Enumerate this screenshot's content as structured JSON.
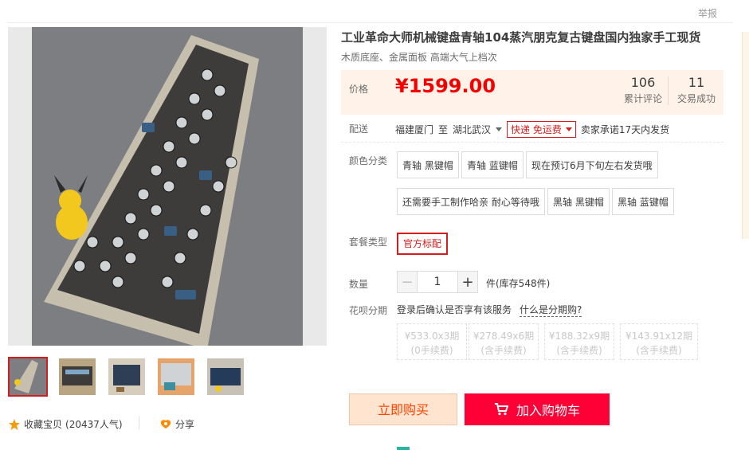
{
  "header": {
    "report_label": "举报"
  },
  "product": {
    "title": "工业革命大师机械键盘青轴104蒸汽朋克复古键盘国内独家手工现货",
    "subtitle": "木质底座、金属面板 高端大气上档次",
    "image_alt_icon": "keyboard-photo"
  },
  "gallery": {
    "thumbnail_count": 5,
    "active_index": 0
  },
  "price": {
    "label": "价格",
    "value": "¥1599.00"
  },
  "stats": [
    {
      "num": "106",
      "label": "累计评论"
    },
    {
      "num": "11",
      "label": "交易成功"
    }
  ],
  "delivery": {
    "label": "配送",
    "from": "福建厦门",
    "to_word": "至",
    "dest": "湖北武汉",
    "shipping": "快递 免运费",
    "promise": "卖家承诺17天内发货"
  },
  "color": {
    "label": "颜色分类",
    "options": [
      "青轴 黑键帽",
      "青轴 蓝键帽",
      "现在预订6月下旬左右发货哦",
      "还需要手工制作哈亲 耐心等待哦",
      "黑轴 黑键帽",
      "黑轴 蓝键帽"
    ]
  },
  "package": {
    "label": "套餐类型",
    "options": [
      "官方标配"
    ],
    "selected": 0
  },
  "quantity": {
    "label": "数量",
    "value": "1",
    "minus": "−",
    "plus": "+",
    "stock": "件(库存548件)"
  },
  "huabei": {
    "label": "花呗分期",
    "text": "登录后确认是否享有该服务",
    "link": "什么是分期购?",
    "plans": [
      {
        "amount": "¥533.0x3期",
        "fee": "(0手续费)"
      },
      {
        "amount": "¥278.49x6期",
        "fee": "(含手续费)"
      },
      {
        "amount": "¥188.32x9期",
        "fee": "(含手续费)"
      },
      {
        "amount": "¥143.91x12期",
        "fee": "(含手续费)"
      }
    ]
  },
  "actions": {
    "buy_now": "立即购买",
    "add_cart": "加入购物车"
  },
  "footer": {
    "favorite_label": "收藏宝贝",
    "favorite_count": "(20437人气)",
    "share_label": "分享"
  },
  "colors": {
    "accent": "#f40000",
    "cart": "#ff0036",
    "price_bg": "#fff2e8"
  }
}
